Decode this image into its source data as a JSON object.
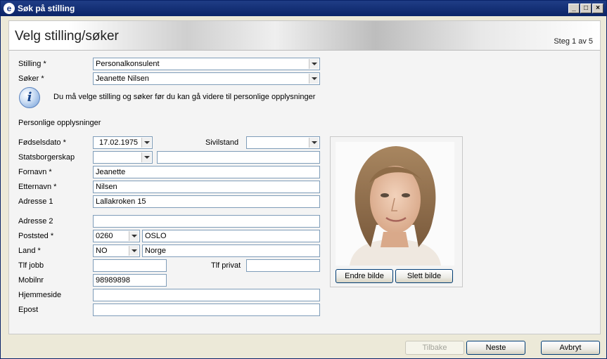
{
  "window": {
    "title": "Søk på stilling",
    "icon": "e-app-icon"
  },
  "header": {
    "title": "Velg stilling/søker",
    "step": "Steg 1 av 5"
  },
  "top": {
    "stilling_label": "Stilling *",
    "stilling_value": "Personalkonsulent",
    "soker_label": "Søker *",
    "soker_value": "Jeanette Nilsen",
    "info_text": "Du må velge stilling og søker før du kan gå videre til personlige opplysninger"
  },
  "personal": {
    "section_title": "Personlige opplysninger",
    "fodselsdato_label": "Fødselsdato *",
    "fodselsdato_value": "17.02.1975",
    "sivilstand_label": "Sivilstand",
    "sivilstand_value": "",
    "statsborgerskap_label": "Statsborgerskap",
    "statsborgerskap_code": "",
    "statsborgerskap_name": "",
    "fornavn_label": "Fornavn *",
    "fornavn_value": "Jeanette",
    "etternavn_label": "Etternavn *",
    "etternavn_value": "Nilsen",
    "adresse1_label": "Adresse 1",
    "adresse1_value": "Lallakroken 15",
    "adresse2_label": "Adresse 2",
    "adresse2_value": "",
    "poststed_label": "Poststed *",
    "postnr_value": "0260",
    "poststed_value": "OSLO",
    "land_label": "Land *",
    "land_code": "NO",
    "land_name": "Norge",
    "tlf_jobb_label": "Tlf jobb",
    "tlf_jobb_value": "",
    "tlf_privat_label": "Tlf privat",
    "tlf_privat_value": "",
    "mobilnr_label": "Mobilnr",
    "mobilnr_value": "98989898",
    "hjemmeside_label": "Hjemmeside",
    "hjemmeside_value": "",
    "epost_label": "Epost",
    "epost_value": ""
  },
  "photo": {
    "change_label": "Endre bilde",
    "delete_label": "Slett bilde"
  },
  "footer": {
    "back_label": "Tilbake",
    "next_label": "Neste",
    "cancel_label": "Avbryt"
  }
}
